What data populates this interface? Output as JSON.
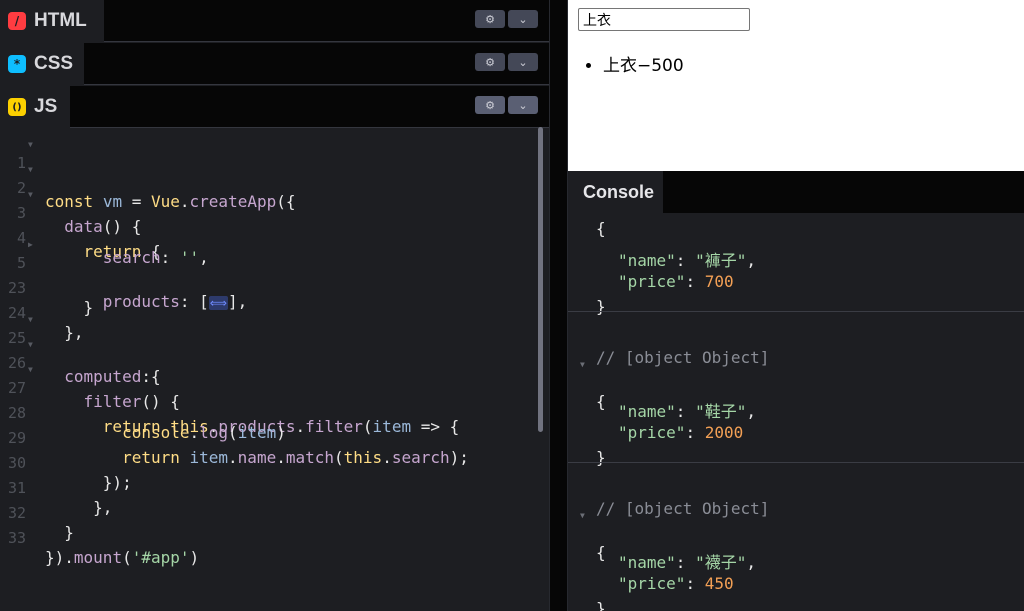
{
  "editor": {
    "panels": [
      {
        "name": "HTML",
        "badge": "/",
        "badge_color": "#ff3c41",
        "badge_text_color": "#1d1e22"
      },
      {
        "name": "CSS",
        "badge": "*",
        "badge_color": "#0ebeff",
        "badge_text_color": "#1d1e22"
      },
      {
        "name": "JS",
        "badge": "()",
        "badge_color": "#fcd000",
        "badge_text_color": "#1d1e22"
      }
    ],
    "settings_icon": "gear-icon",
    "collapse_icon": "chevron-down-icon",
    "line_numbers": [
      "1",
      "2",
      "3",
      "4",
      "5",
      "23",
      "24",
      "25",
      "26",
      "27",
      "28",
      "29",
      "30",
      "31",
      "32",
      "33"
    ],
    "folded_marker": "⟺"
  },
  "preview": {
    "search_value": "上衣",
    "results": [
      "上衣−500"
    ]
  },
  "console": {
    "tab_label": "Console",
    "top_brace": "{",
    "entries": [
      {
        "comment": "",
        "open": "",
        "name_key": "\"name\"",
        "name_value": "\"褲子\"",
        "price_key": "\"price\"",
        "price_value": "700",
        "close": "}"
      },
      {
        "comment": "// [object Object]",
        "open": "{",
        "name_key": "\"name\"",
        "name_value": "\"鞋子\"",
        "price_key": "\"price\"",
        "price_value": "2000",
        "close": "}"
      },
      {
        "comment": "// [object Object]",
        "open": "{",
        "name_key": "\"name\"",
        "name_value": "\"襪子\"",
        "price_key": "\"price\"",
        "price_value": "450",
        "close": "}"
      }
    ]
  }
}
